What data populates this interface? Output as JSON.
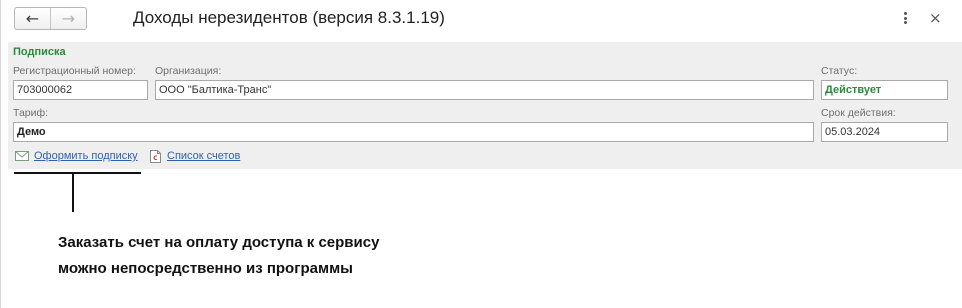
{
  "window": {
    "title": "Доходы нерезидентов (версия 8.3.1.19)",
    "back_icon": "arrow-left-icon",
    "forward_icon": "arrow-right-icon",
    "more_icon": "more-vertical-icon",
    "close_icon": "close-icon",
    "back_glyph": "←",
    "forward_glyph": "→",
    "close_glyph": "×"
  },
  "subscription": {
    "group_title": "Подписка",
    "reg_number_label": "Регистрационный номер:",
    "reg_number_value": "703000062",
    "organization_label": "Организация:",
    "organization_value": "ООО \"Балтика-Транс\"",
    "status_label": "Статус:",
    "status_value": "Действует",
    "tariff_label": "Тариф:",
    "tariff_value": "Демо",
    "validity_label": "Срок действия:",
    "validity_value": "05.03.2024"
  },
  "links": {
    "subscribe": "Оформить подписку",
    "subscribe_icon": "envelope-icon",
    "invoices": "Список счетов",
    "invoices_icon": "invoice-document-icon"
  },
  "callout": {
    "line1": "Заказать счет на оплату доступа к сервису",
    "line2": "можно непосредственно из программы"
  },
  "colors": {
    "accent_green": "#2a8a3c",
    "link_blue": "#3061b0",
    "panel_bg": "#efefef"
  }
}
